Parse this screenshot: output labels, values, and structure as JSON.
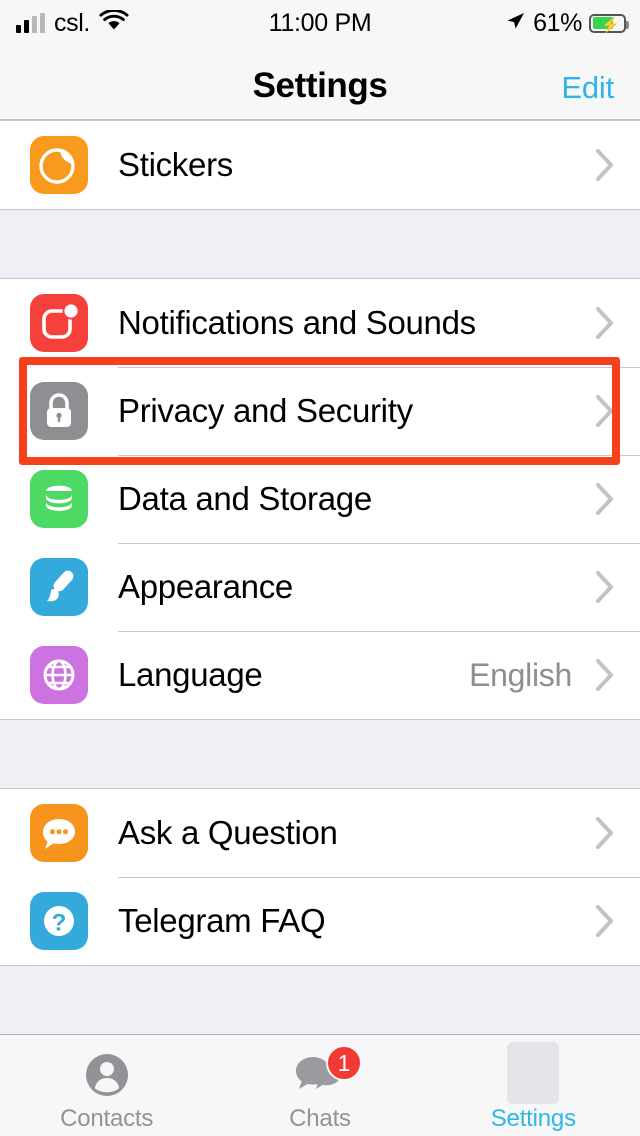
{
  "status_bar": {
    "carrier": "csl.",
    "time": "11:00 PM",
    "battery_percent": "61%",
    "wifi_icon": "wifi-icon",
    "location_icon": "location-arrow-icon",
    "battery_icon": "battery-charging-icon",
    "signal_icon": "cellular-signal-icon"
  },
  "nav": {
    "title": "Settings",
    "edit_label": "Edit"
  },
  "groups": [
    {
      "rows": [
        {
          "label": "Stickers",
          "value": "",
          "icon": "sticker-icon",
          "color": "#f79a1e",
          "highlighted": false
        }
      ]
    },
    {
      "rows": [
        {
          "label": "Notifications and Sounds",
          "value": "",
          "icon": "notifications-icon",
          "color": "#f5403c",
          "highlighted": false
        },
        {
          "label": "Privacy and Security",
          "value": "",
          "icon": "lock-icon",
          "color": "#8e8e93",
          "highlighted": true
        },
        {
          "label": "Data and Storage",
          "value": "",
          "icon": "database-icon",
          "color": "#4cd964",
          "highlighted": false
        },
        {
          "label": "Appearance",
          "value": "",
          "icon": "paintbrush-icon",
          "color": "#34aadc",
          "highlighted": false
        },
        {
          "label": "Language",
          "value": "English",
          "icon": "globe-icon",
          "color": "#cc73e1",
          "highlighted": false
        }
      ]
    },
    {
      "rows": [
        {
          "label": "Ask a Question",
          "value": "",
          "icon": "question-bubble-icon",
          "color": "#f7941e",
          "highlighted": false
        },
        {
          "label": "Telegram FAQ",
          "value": "",
          "icon": "faq-icon",
          "color": "#34aadc",
          "highlighted": false
        }
      ]
    }
  ],
  "tabs": [
    {
      "label": "Contacts",
      "icon": "contacts-person-icon",
      "badge": "",
      "active": false
    },
    {
      "label": "Chats",
      "icon": "chats-bubbles-icon",
      "badge": "1",
      "active": false
    },
    {
      "label": "Settings",
      "icon": "settings-placeholder-icon",
      "badge": "",
      "active": true
    }
  ],
  "annotation": {
    "highlight_color": "#f4401b",
    "target": "Privacy and Security"
  },
  "rows_flat": {
    "r0": "Stickers",
    "r1": "Notifications and Sounds",
    "r2": "Privacy and Security",
    "r3": "Data and Storage",
    "r4": "Appearance",
    "r5": "Language",
    "r5v": "English",
    "r6": "Ask a Question",
    "r7": "Telegram FAQ"
  }
}
